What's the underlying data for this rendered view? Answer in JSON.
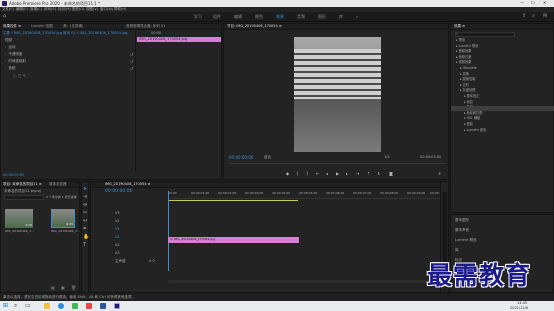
{
  "titlebar": {
    "title": "Adobe Premiere Pro 2020 - 未命名的项目11.1 *"
  },
  "menubar": {
    "items": [
      "文件(F)",
      "编辑(E)",
      "剪辑(C)",
      "序列(S)",
      "标记(M)",
      "图形(G)",
      "视图(V)",
      "窗口(W)",
      "帮助(H)"
    ]
  },
  "workspace": {
    "tabs": [
      "学习",
      "组件",
      "编辑",
      "颜色",
      "效果",
      "音频",
      "图形",
      "库"
    ],
    "active_index": 4,
    "more": "»"
  },
  "effect_controls": {
    "tabs": [
      "效果控件 ≡",
      "Lumetri 范围",
      "源：(无剪辑)",
      "音频剪辑混合器: 序列 01"
    ],
    "source_row": "主要 * IMG_20190406_170054.jpg",
    "clip_row": "序列 01 * IMG_20190406_170054.jpg",
    "timecode_top": "00:00",
    "clip_label": "IMG_20190406_170054.jpg",
    "sections": [
      "视频",
      "运动",
      "不透明度",
      "时间重映射",
      "音频"
    ],
    "footer_time": "00:00:00:00"
  },
  "program": {
    "tab": "节目: IMG_20190406_170054 ≡",
    "tc_left": "00:00:00:00",
    "fit": "适合",
    "quality": "1/2",
    "tc_right": "00:00:03:00"
  },
  "effects": {
    "header": "效果 ≡",
    "items": [
      "预设",
      "Lumetri 预设",
      "音频效果",
      "音频过渡",
      "视频效果",
      "Obsolete",
      "变换",
      "图像控制",
      "过时",
      "灰度处理",
      "颜色平衡 (HLS)",
      "黑白",
      "杂色与颗粒",
      "模糊与锐化",
      "沉浸式视频",
      "生成",
      "视频",
      "调整",
      "过渡",
      "透视",
      "通道",
      "键控",
      "颜色校正",
      "风格化",
      "视频过渡",
      "Lumetri 颜色"
    ],
    "selected_index": 10,
    "sub": [
      "基本校正",
      "创意",
      "曲线",
      "色轮和匹配",
      "HSL 辅助",
      "晕影",
      "Lumetri 颜色"
    ]
  },
  "project": {
    "tabs": [
      "项目: 未命名的项目11 ≡",
      "媒体浏览器"
    ],
    "file": "未命名的项目11.prproj",
    "item_count": "2 个项中的 1 项已选择",
    "items": [
      {
        "name": "IMG_20190406_1...",
        "dur": "4:29"
      },
      {
        "name": "IMG_20190406_1...",
        "dur": "4:29"
      }
    ]
  },
  "timeline": {
    "tab": "IMG_20190406_170054 ≡",
    "timecode": "00:00:00:00",
    "ruler": [
      "00:00",
      "00:00:01:00",
      "00:00:02:00",
      "00:00:03:00",
      "00:00:04:00",
      "00:00:05:00",
      "00:00:06:00",
      "00:00:07:00",
      "00:00:08:00",
      "00:00:09:00",
      "00:00:10:00"
    ],
    "tracks": [
      "V3",
      "V2",
      "V1",
      "A1",
      "A2",
      "A3"
    ],
    "master": "主声道",
    "master_val": "0.0",
    "clip": "fx IMG_20190406_170054.jpg"
  },
  "right_bottom": {
    "items": [
      "基本图形",
      "基本声音",
      "Lumetri 颜色",
      "库",
      "标记",
      "历史记录",
      "信息"
    ]
  },
  "status": {
    "text": "单击以选择，或在空白区域拖动进行框选。使用 Shift、Alt 和 Ctrl 可获得其他选项。"
  },
  "taskbar": {
    "time": "14:45",
    "date": "2021/11/6"
  },
  "watermark": {
    "text": "最需教育"
  },
  "colors": {
    "accent": "#3a8fd6",
    "clip": "#d87dd3",
    "watermark": "#1a1a8a"
  }
}
